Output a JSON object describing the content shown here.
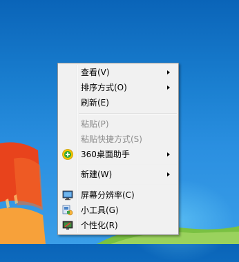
{
  "desktop": {
    "colors": {
      "background": "#1a7fd0",
      "logo_red": "#e8431c",
      "logo_orange": "#f7a13a",
      "logo_green": "#7ac142"
    }
  },
  "context_menu": {
    "items": [
      {
        "label": "查看(V)",
        "submenu": true,
        "enabled": true
      },
      {
        "label": "排序方式(O)",
        "submenu": true,
        "enabled": true
      },
      {
        "label": "刷新(E)",
        "submenu": false,
        "enabled": true
      },
      {
        "label": "粘贴(P)",
        "submenu": false,
        "enabled": false
      },
      {
        "label": "粘贴快捷方式(S)",
        "submenu": false,
        "enabled": false
      },
      {
        "label": "360桌面助手",
        "submenu": true,
        "enabled": true,
        "icon": "360-assistant-icon"
      },
      {
        "label": "新建(W)",
        "submenu": true,
        "enabled": true
      },
      {
        "label": "屏幕分辨率(C)",
        "submenu": false,
        "enabled": true,
        "icon": "screen-resolution-icon"
      },
      {
        "label": "小工具(G)",
        "submenu": false,
        "enabled": true,
        "icon": "gadgets-icon"
      },
      {
        "label": "个性化(R)",
        "submenu": false,
        "enabled": true,
        "icon": "personalize-icon"
      }
    ]
  }
}
